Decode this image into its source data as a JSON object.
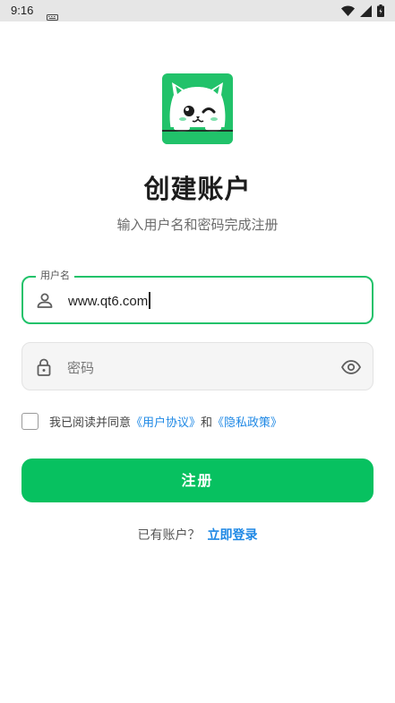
{
  "status_bar": {
    "time": "9:16",
    "keyboard_icon": "keyboard-icon",
    "icons": [
      "wifi-icon",
      "signal-icon",
      "battery-icon"
    ]
  },
  "logo": {
    "icon": "cat-logo-icon",
    "color": "#21c26a"
  },
  "title": "创建账户",
  "subtitle": "输入用户名和密码完成注册",
  "username": {
    "label": "用户名",
    "value": "www.qt6.com",
    "icon": "person-icon"
  },
  "password": {
    "placeholder": "密码",
    "icon": "lock-icon",
    "toggle_icon": "eye-icon"
  },
  "agreement": {
    "prefix": "我已阅读并同意",
    "terms": "《用户协议》",
    "and": "和",
    "privacy": "《隐私政策》",
    "checked": false
  },
  "register_button": "注册",
  "footer": {
    "prompt": "已有账户？",
    "login_link": "立即登录"
  },
  "colors": {
    "accent": "#07c160",
    "link": "#1e88e5"
  }
}
